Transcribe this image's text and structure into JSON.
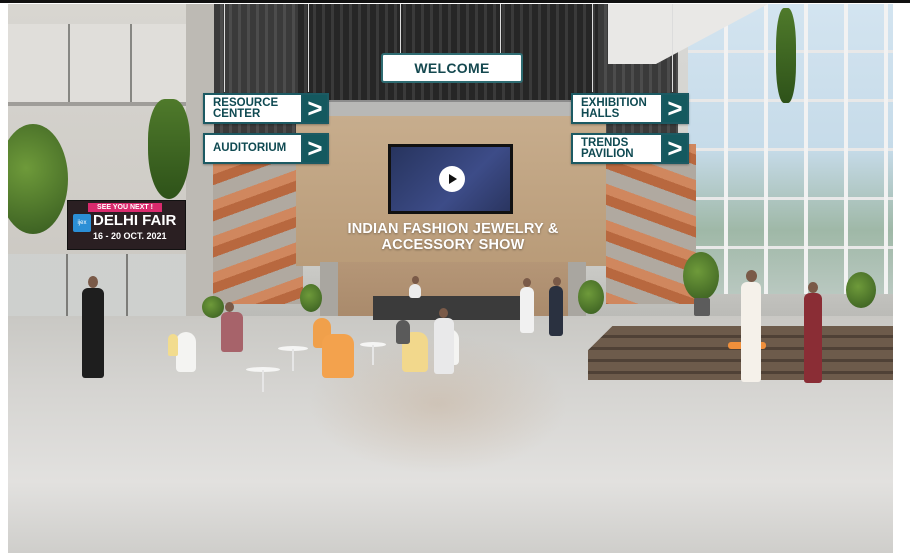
{
  "welcome": {
    "label": "WELCOME"
  },
  "nav": {
    "resource_center": "RESOURCE CENTER",
    "auditorium": "AUDITORIUM",
    "exhibition_halls": "EXHIBITION HALLS",
    "trends_pavilion": "TRENDS PAVILION",
    "arrow": ">"
  },
  "show": {
    "title_line1": "INDIAN FASHION JEWELRY &",
    "title_line2": "ACCESSORY SHOW"
  },
  "fair_board": {
    "tagline": "SEE YOU NEXT !",
    "logo_text": "ijex",
    "name": "DELHI FAIR",
    "dates": "16 - 20 OCT. 2021"
  },
  "colors": {
    "sign_teal": "#14595f",
    "sign_text": "#0f4a52",
    "board_pink": "#d92a6d"
  },
  "icons": {
    "video": "play-icon",
    "nav": "chevron-right-icon"
  }
}
